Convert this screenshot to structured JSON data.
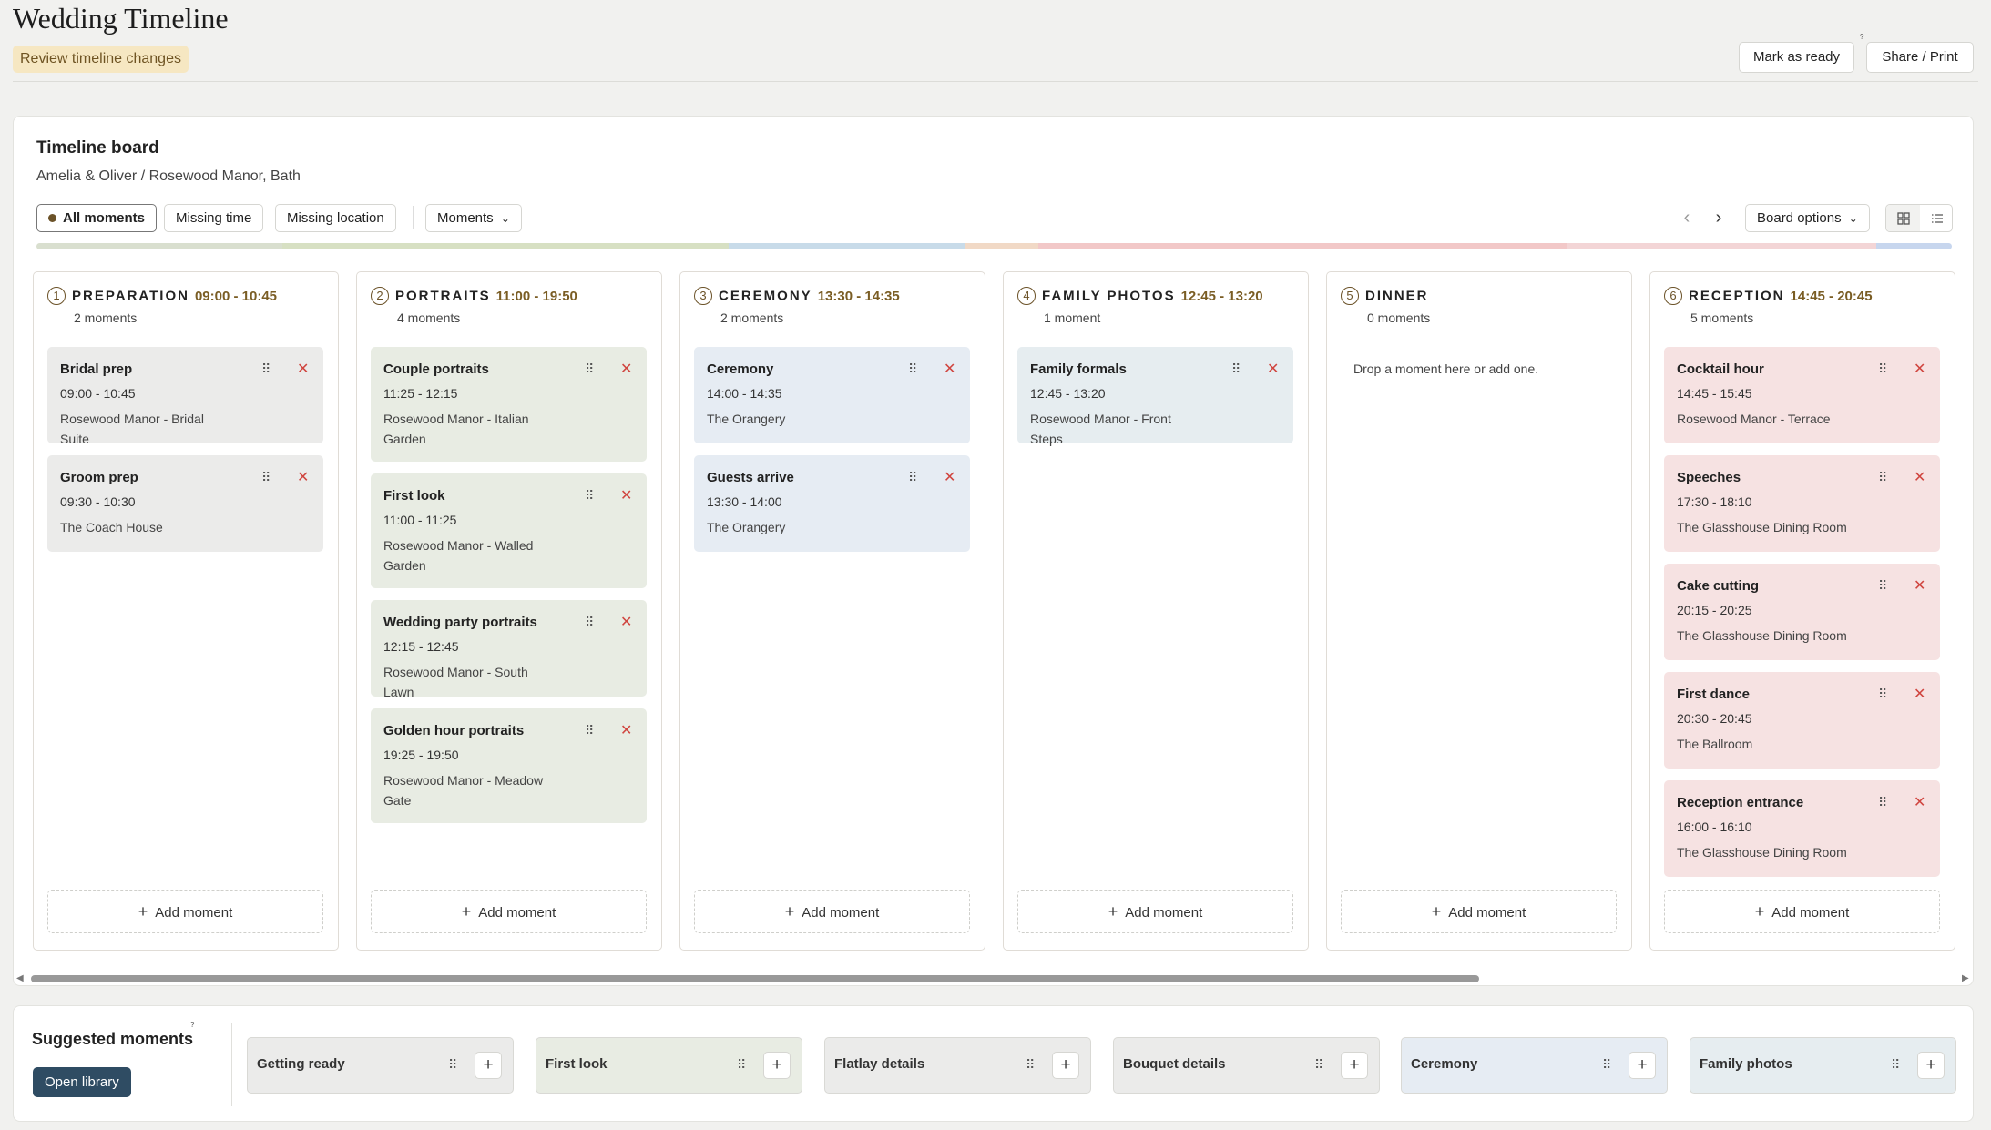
{
  "header": {
    "title": "Wedding Timeline",
    "review_badge": "Review timeline changes",
    "mark_ready": "Mark as ready",
    "share_print": "Share / Print",
    "help_mark": "?"
  },
  "board": {
    "title": "Timeline board",
    "subtitle": "Amelia & Oliver / Rosewood Manor, Bath",
    "filters": [
      "All moments",
      "Missing time",
      "Missing location"
    ],
    "moments_dropdown": "Moments",
    "board_options": "Board options",
    "nav_prev": "‹",
    "nav_next": "›",
    "add_label": "Add moment",
    "stripe_colors": [
      "#d9dfcf",
      "#d7e0c3",
      "#c8dbe9",
      "#f1d9c6",
      "#f2c8c8",
      "#f3d5d6",
      "#c7d6ee"
    ],
    "columns": [
      {
        "num": "1",
        "name": "PREPARATION",
        "range": "09:00 - 10:45",
        "count": "2 moments",
        "card_color": "#ebebea",
        "empty_text": "",
        "cards": [
          {
            "title": "Bridal prep",
            "time": "09:00 - 10:45",
            "location": "Rosewood Manor - Bridal Suite"
          },
          {
            "title": "Groom prep",
            "time": "09:30 - 10:30",
            "location": "The Coach House"
          }
        ]
      },
      {
        "num": "2",
        "name": "PORTRAITS",
        "range": "11:00 - 19:50",
        "count": "4 moments",
        "card_color": "#e8ece3",
        "empty_text": "",
        "cards": [
          {
            "title": "Couple portraits",
            "time": "11:25 - 12:15",
            "location": "Rosewood Manor - Italian Garden"
          },
          {
            "title": "First look",
            "time": "11:00 - 11:25",
            "location": "Rosewood Manor - Walled Garden"
          },
          {
            "title": "Wedding party portraits",
            "time": "12:15 - 12:45",
            "location": "Rosewood Manor - South Lawn"
          },
          {
            "title": "Golden hour portraits",
            "time": "19:25 - 19:50",
            "location": "Rosewood Manor - Meadow Gate"
          }
        ]
      },
      {
        "num": "3",
        "name": "CEREMONY",
        "range": "13:30 - 14:35",
        "count": "2 moments",
        "card_color": "#e6ecf3",
        "empty_text": "",
        "cards": [
          {
            "title": "Ceremony",
            "time": "14:00 - 14:35",
            "location": "The Orangery"
          },
          {
            "title": "Guests arrive",
            "time": "13:30 - 14:00",
            "location": "The Orangery"
          }
        ]
      },
      {
        "num": "4",
        "name": "FAMILY PHOTOS",
        "range": "12:45 - 13:20",
        "count": "1 moment",
        "card_color": "#e6edf0",
        "empty_text": "",
        "cards": [
          {
            "title": "Family formals",
            "time": "12:45 - 13:20",
            "location": "Rosewood Manor - Front Steps"
          }
        ]
      },
      {
        "num": "5",
        "name": "DINNER",
        "range": "",
        "count": "0 moments",
        "card_color": "#ffffff",
        "empty_text": "Drop a moment here or add one.",
        "cards": []
      },
      {
        "num": "6",
        "name": "RECEPTION",
        "range": "14:45 - 20:45",
        "count": "5 moments",
        "card_color": "#f6e2e2",
        "empty_text": "",
        "cards": [
          {
            "title": "Cocktail hour",
            "time": "14:45 - 15:45",
            "location": "Rosewood Manor - Terrace"
          },
          {
            "title": "Speeches",
            "time": "17:30 - 18:10",
            "location": "The Glasshouse Dining Room"
          },
          {
            "title": "Cake cutting",
            "time": "20:15 - 20:25",
            "location": "The Glasshouse Dining Room"
          },
          {
            "title": "First dance",
            "time": "20:30 - 20:45",
            "location": "The Ballroom"
          },
          {
            "title": "Reception entrance",
            "time": "16:00 - 16:10",
            "location": "The Glasshouse Dining Room"
          }
        ]
      }
    ]
  },
  "icons": {
    "drag": "⠿",
    "remove": "✕",
    "plus": "+",
    "chevron_down": "⌄",
    "grid_view": "grid-icon",
    "list_view": "list-icon"
  },
  "suggested": {
    "title": "Suggested moments",
    "help_mark": "?",
    "library_button": "Open library",
    "items": [
      {
        "label": "Getting ready",
        "color": "#ebebea"
      },
      {
        "label": "First look",
        "color": "#e8ece3"
      },
      {
        "label": "Flatlay details",
        "color": "#ebebea"
      },
      {
        "label": "Bouquet details",
        "color": "#ebebea"
      },
      {
        "label": "Ceremony",
        "color": "#e6ecf3"
      },
      {
        "label": "Family photos",
        "color": "#e6edf0"
      }
    ]
  }
}
